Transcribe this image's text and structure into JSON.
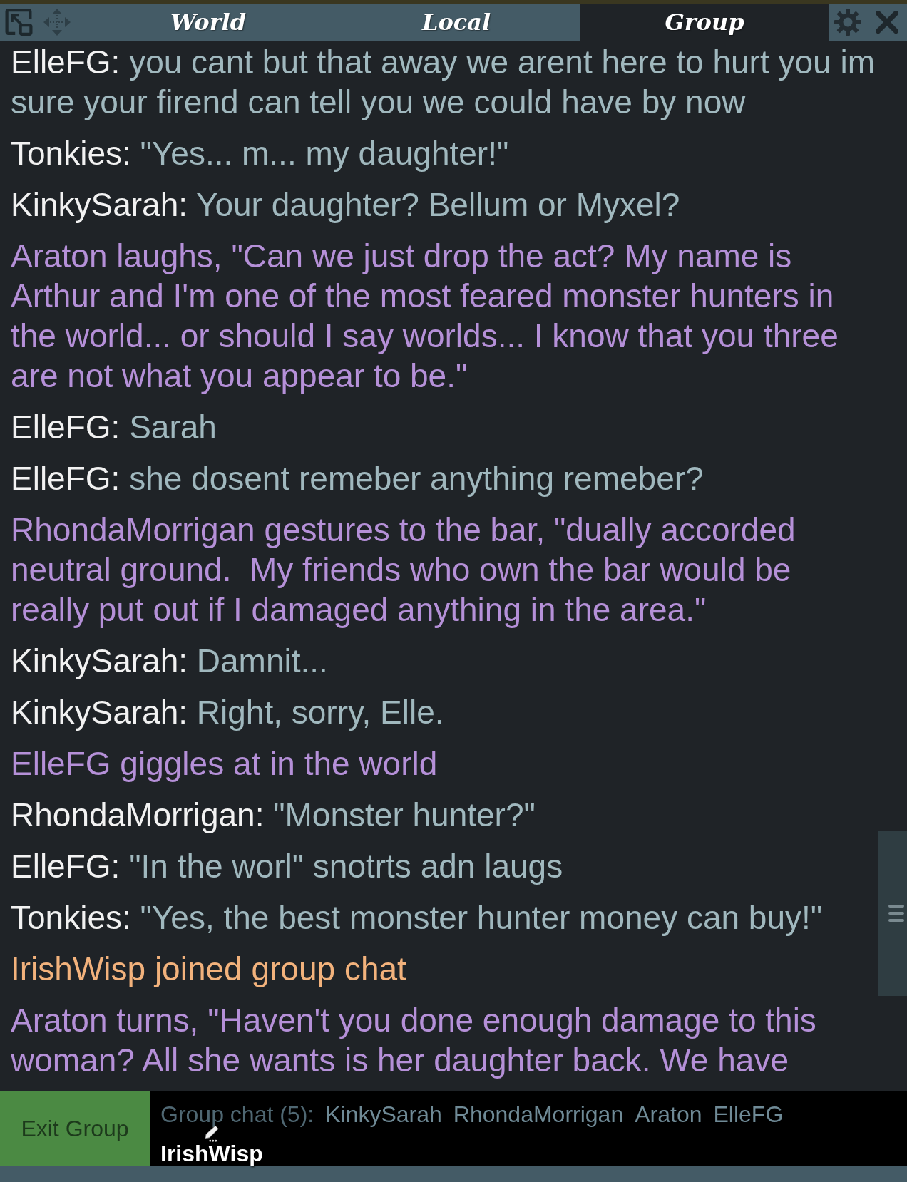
{
  "toolbar": {
    "tabs": [
      {
        "label": "World",
        "selected": false
      },
      {
        "label": "Local",
        "selected": false
      },
      {
        "label": "Group",
        "selected": true
      }
    ]
  },
  "messages": [
    {
      "kind": "say",
      "speaker": "ElleFG:",
      "text": "you cant but that away we arent here to hurt you im sure your firend can tell you we could have by now"
    },
    {
      "kind": "say",
      "speaker": "Tonkies:",
      "text": "\"Yes... m... my daughter!\""
    },
    {
      "kind": "say",
      "speaker": "KinkySarah:",
      "text": "Your daughter? Bellum or Myxel?"
    },
    {
      "kind": "emote",
      "text": "Araton laughs, \"Can we just drop the act? My name is Arthur and I'm one of the most feared monster hunters in the world... or should I say worlds... I know that you three are not what you appear to be.\""
    },
    {
      "kind": "say",
      "speaker": "ElleFG:",
      "text": "Sarah"
    },
    {
      "kind": "say",
      "speaker": "ElleFG:",
      "text": "she dosent remeber anything remeber?"
    },
    {
      "kind": "emote",
      "text": "RhondaMorrigan gestures to the bar, \"dually accorded neutral ground.  My friends who own the bar would be really put out if I damaged anything in the area.\""
    },
    {
      "kind": "say",
      "speaker": "KinkySarah:",
      "text": "Damnit..."
    },
    {
      "kind": "say",
      "speaker": "KinkySarah:",
      "text": "Right, sorry, Elle."
    },
    {
      "kind": "emote",
      "text": "ElleFG giggles at in the world"
    },
    {
      "kind": "say",
      "speaker": "RhondaMorrigan:",
      "text": "\"Monster hunter?\""
    },
    {
      "kind": "say",
      "speaker": "ElleFG:",
      "text": "\"In the worl\" snotrts adn laugs"
    },
    {
      "kind": "say",
      "speaker": "Tonkies:",
      "text": "\"Yes, the best monster hunter money can buy!\""
    },
    {
      "kind": "system",
      "text": "IrishWisp joined group chat"
    },
    {
      "kind": "emote",
      "text": "Araton turns, \"Haven't you done enough damage to this woman? All she wants is her daughter back. We have"
    }
  ],
  "footer": {
    "exit_button": "Exit Group",
    "members_label": "Group chat (5):",
    "members": [
      {
        "name": "KinkySarah",
        "typing": false
      },
      {
        "name": "RhondaMorrigan",
        "typing": false
      },
      {
        "name": "Araton",
        "typing": false
      },
      {
        "name": "ElleFG",
        "typing": false
      },
      {
        "name": "IrishWisp",
        "typing": true
      }
    ]
  }
}
